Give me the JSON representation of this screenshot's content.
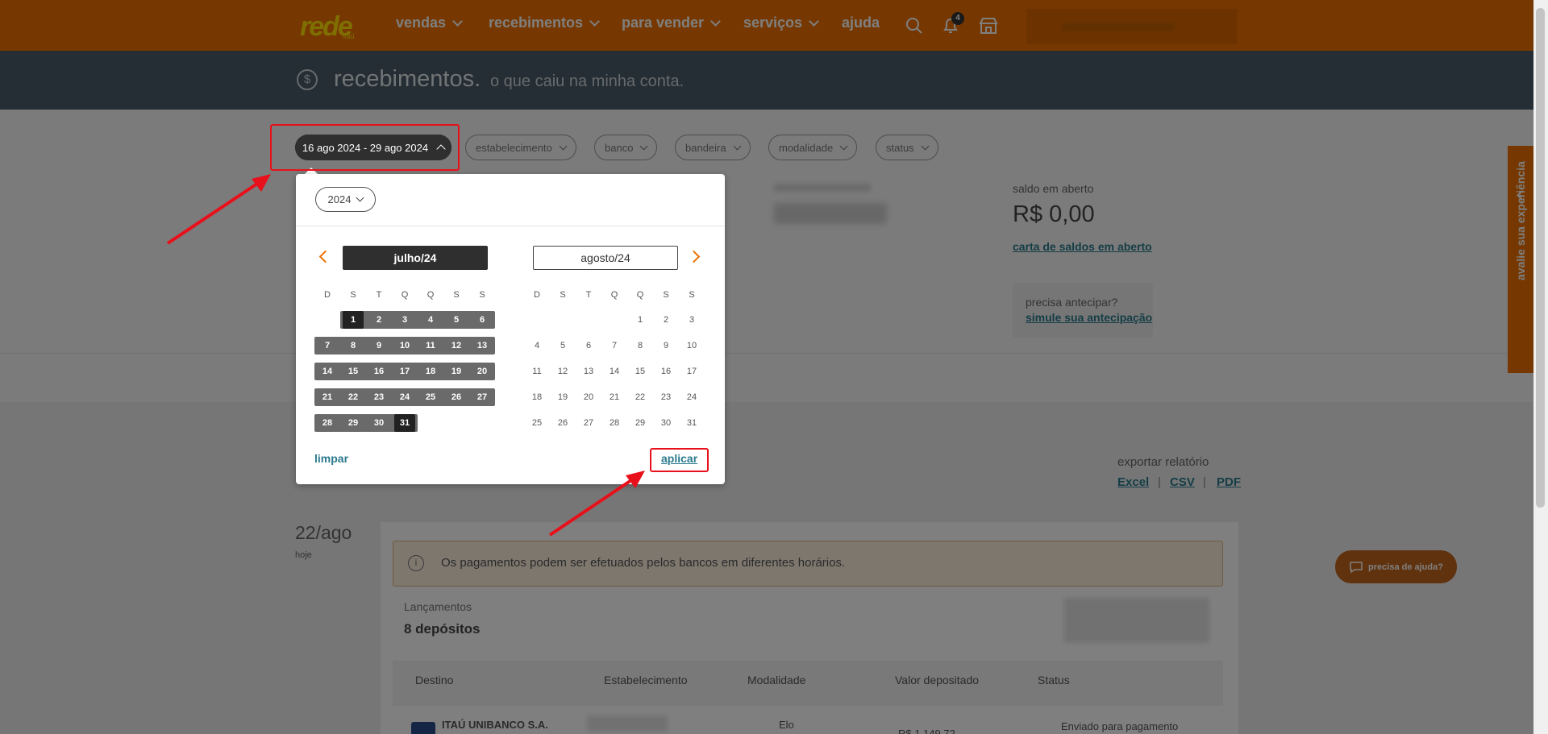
{
  "nav": {
    "logo": "rede",
    "logo_sub": "itaú",
    "items": [
      {
        "label": "vendas"
      },
      {
        "label": "recebimentos"
      },
      {
        "label": "para vender"
      },
      {
        "label": "serviços"
      }
    ],
    "help": "ajuda",
    "notification_count": "4"
  },
  "header": {
    "title": "recebimentos.",
    "subtitle": "o que caiu na minha conta."
  },
  "filters": {
    "date_range": "16 ago 2024 - 29 ago 2024",
    "pills": [
      "estabelecimento",
      "banco",
      "bandeira",
      "modalidade",
      "status"
    ]
  },
  "summary": {
    "open_balance_label": "saldo em aberto",
    "open_balance_value": "R$ 0,00",
    "open_balance_link": "carta de saldos em aberto",
    "antecipar_question": "precisa antecipar?",
    "antecipar_link": "simule sua antecipação"
  },
  "export": {
    "label": "exportar relatório",
    "links": [
      "Excel",
      "CSV",
      "PDF"
    ],
    "separator": "|"
  },
  "day_section": {
    "date": "22/ago",
    "relative": "hoje"
  },
  "info": {
    "icon": "i",
    "text": "Os pagamentos podem ser efetuados pelos bancos em diferentes horários."
  },
  "lancamentos": {
    "label": "Lançamentos",
    "value": "8 depósitos"
  },
  "table": {
    "headers": [
      "Destino",
      "Estabelecimento",
      "Modalidade",
      "Valor depositado",
      "Status"
    ],
    "first_row": {
      "destino": "ITAÚ UNIBANCO S.A.",
      "modalidade": "Elo",
      "valor": "R$ 1.149,72",
      "status": "Enviado para pagamento"
    }
  },
  "help_button": "precisa de ajuda?",
  "feedback_tab": "avalie sua experiência",
  "calendar": {
    "year": "2024",
    "left_month": "julho/24",
    "right_month": "agosto/24",
    "weekdays": [
      "D",
      "S",
      "T",
      "Q",
      "Q",
      "S",
      "S"
    ],
    "left_days": [
      "1",
      "2",
      "3",
      "4",
      "5",
      "6",
      "7",
      "8",
      "9",
      "10",
      "11",
      "12",
      "13",
      "14",
      "15",
      "16",
      "17",
      "18",
      "19",
      "20",
      "21",
      "22",
      "23",
      "24",
      "25",
      "26",
      "27",
      "28",
      "29",
      "30",
      "31"
    ],
    "left_start_weekday": 1,
    "right_days": [
      "1",
      "2",
      "3",
      "4",
      "5",
      "6",
      "7",
      "8",
      "9",
      "10",
      "11",
      "12",
      "13",
      "14",
      "15",
      "16",
      "17",
      "18",
      "19",
      "20",
      "21",
      "22",
      "23",
      "24",
      "25",
      "26",
      "27",
      "28",
      "29",
      "30",
      "31"
    ],
    "right_start_weekday": 4,
    "selected_start": "1",
    "selected_end": "31",
    "clear_label": "limpar",
    "apply_label": "aplicar"
  },
  "colors": {
    "brand_orange": "#ec7000",
    "logo_yellow": "#ffdd00",
    "header_band": "#4a5c68",
    "link_teal": "#2a7a8c",
    "annotation_red": "#e8101b"
  }
}
